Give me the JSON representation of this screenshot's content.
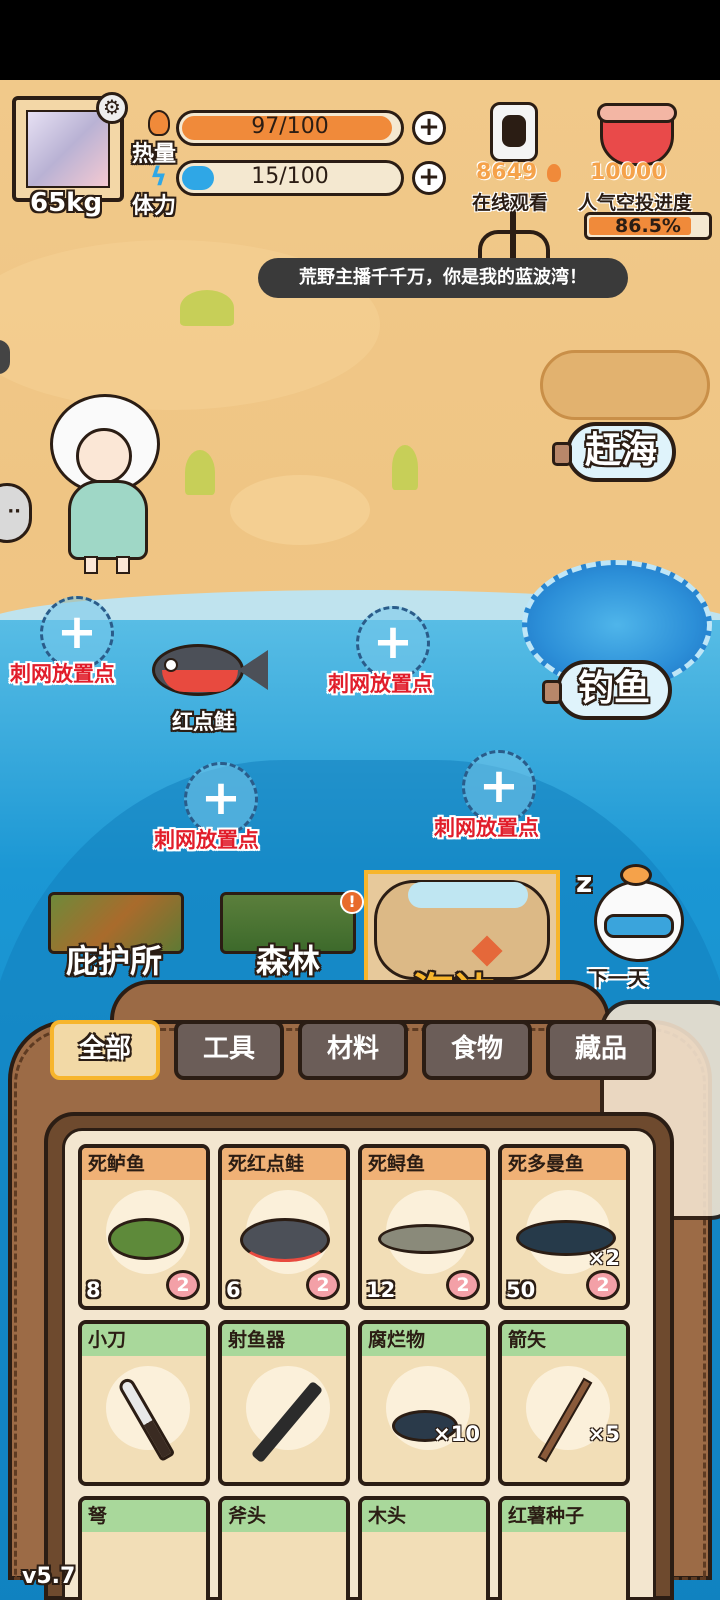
{
  "player": {
    "weight": "65kg",
    "calories_label": "热量",
    "calories_value": "97/100",
    "calories_fraction": 0.97,
    "stamina_label": "体力",
    "stamina_value": "15/100",
    "stamina_fraction": 0.15
  },
  "stream": {
    "viewers": "8649",
    "viewers_label": "在线观看",
    "airdrop_value": "10000",
    "airdrop_label": "人气空投进度",
    "airdrop_percent_text": "86.5%",
    "airdrop_fraction": 0.865,
    "banner": "荒野主播千千万，你是我的蓝波湾！"
  },
  "actions": {
    "beachcomb": "赶海",
    "fishing": "钓鱼",
    "next_day": "下一天"
  },
  "net_spots": [
    {
      "label": "刺网放置点"
    },
    {
      "label": "刺网放置点"
    },
    {
      "label": "刺网放置点"
    },
    {
      "label": "刺网放置点"
    }
  ],
  "caught_fish_label": "红点鲑",
  "locations": [
    {
      "label": "庇护所"
    },
    {
      "label": "森林"
    },
    {
      "label": "海边"
    }
  ],
  "tabs": [
    {
      "label": "全部"
    },
    {
      "label": "工具"
    },
    {
      "label": "材料"
    },
    {
      "label": "食物"
    },
    {
      "label": "藏品"
    }
  ],
  "items": [
    {
      "name": "死鲈鱼",
      "calories": "8",
      "hearts": "2",
      "qty": ""
    },
    {
      "name": "死红点鲑",
      "calories": "6",
      "hearts": "2",
      "qty": ""
    },
    {
      "name": "死鲟鱼",
      "calories": "12",
      "hearts": "2",
      "qty": ""
    },
    {
      "name": "死多曼鱼",
      "calories": "50",
      "hearts": "2",
      "qty": "×2"
    },
    {
      "name": "小刀",
      "qty": ""
    },
    {
      "name": "射鱼器",
      "qty": ""
    },
    {
      "name": "腐烂物",
      "qty": "×10"
    },
    {
      "name": "箭矢",
      "qty": "×5"
    },
    {
      "name": "弩"
    },
    {
      "name": "斧头"
    },
    {
      "name": "木头"
    },
    {
      "name": "红薯种子"
    }
  ],
  "version": "v5.7",
  "colors": {
    "calorie_bar": "#f08a3a",
    "stamina_bar": "#2fa7e6",
    "active_tab_border": "#f7b52c",
    "net_label": "#e11d2a"
  }
}
